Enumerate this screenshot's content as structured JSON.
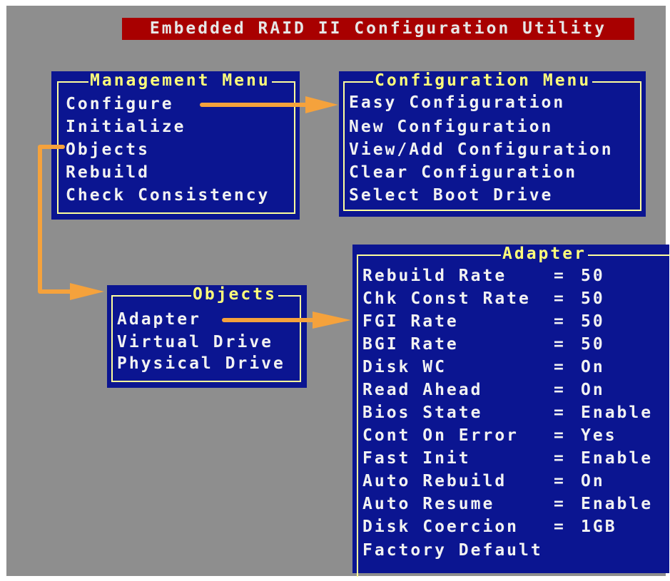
{
  "title": "Embedded RAID II Configuration Utility",
  "colors": {
    "background": "#8e8e8e",
    "title_bar": "#a80000",
    "panel": "#0b1591",
    "frame": "#ffff9c",
    "menu_title": "#ffff7a",
    "menu_text": "#f2f2f2",
    "arrow": "#f5a23c"
  },
  "management_menu": {
    "title": "Management Menu",
    "items": [
      "Configure",
      "Initialize",
      "Objects",
      "Rebuild",
      "Check Consistency"
    ]
  },
  "configuration_menu": {
    "title": "Configuration Menu",
    "items": [
      "Easy Configuration",
      "New Configuration",
      "View/Add Configuration",
      "Clear Configuration",
      "Select Boot Drive"
    ]
  },
  "objects_menu": {
    "title": "Objects",
    "items": [
      "Adapter",
      "Virtual Drive",
      "Physical Drive"
    ]
  },
  "adapter_menu": {
    "title": "Adapter",
    "settings": [
      {
        "label": "Rebuild Rate",
        "value": "50"
      },
      {
        "label": "Chk Const Rate",
        "value": "50"
      },
      {
        "label": "FGI Rate",
        "value": "50"
      },
      {
        "label": "BGI Rate",
        "value": "50"
      },
      {
        "label": "Disk WC",
        "value": "On"
      },
      {
        "label": "Read Ahead",
        "value": "On"
      },
      {
        "label": "Bios State",
        "value": "Enable"
      },
      {
        "label": "Cont On Error",
        "value": "Yes"
      },
      {
        "label": "Fast Init",
        "value": "Enable"
      },
      {
        "label": "Auto Rebuild",
        "value": "On"
      },
      {
        "label": "Auto Resume",
        "value": "Enable"
      },
      {
        "label": "Disk Coercion",
        "value": "1GB"
      }
    ],
    "factory_default": "Factory Default",
    "equals": "="
  }
}
